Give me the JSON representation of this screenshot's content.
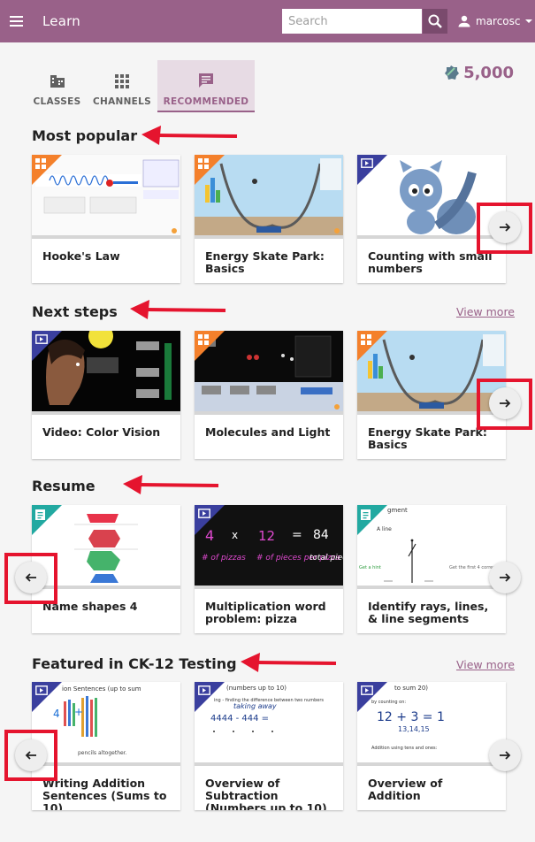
{
  "appbar": {
    "title": "Learn",
    "search_placeholder": "Search",
    "username": "marcosc"
  },
  "tabs": [
    {
      "label": "CLASSES",
      "icon": "classes-icon",
      "active": false
    },
    {
      "label": "CHANNELS",
      "icon": "channels-icon",
      "active": false
    },
    {
      "label": "RECOMMENDED",
      "icon": "recommended-icon",
      "active": true
    }
  ],
  "points": "5,000",
  "sections": [
    {
      "title": "Most popular",
      "view_more": "",
      "cards": [
        {
          "title": "Hooke's Law",
          "kind": "app"
        },
        {
          "title": "Energy Skate Park: Basics",
          "kind": "app"
        },
        {
          "title": "Counting with small numbers",
          "kind": "video"
        }
      ]
    },
    {
      "title": "Next steps",
      "view_more": "View more",
      "cards": [
        {
          "title": "Video: Color Vision",
          "kind": "video"
        },
        {
          "title": "Molecules and Light",
          "kind": "app"
        },
        {
          "title": "Energy Skate Park: Basics",
          "kind": "app"
        }
      ]
    },
    {
      "title": "Resume",
      "view_more": "",
      "cards": [
        {
          "title": "Name shapes 4",
          "kind": "exercise"
        },
        {
          "title": "Multiplication word problem: pizza",
          "kind": "video"
        },
        {
          "title": "Identify rays, lines, & line segments",
          "kind": "exercise"
        }
      ]
    },
    {
      "title": "Featured in CK-12 Testing",
      "view_more": "View more",
      "cards": [
        {
          "title": "Writing Addition Sentences (Sums to 10)",
          "kind": "video"
        },
        {
          "title": "Overview of Subtraction (Numbers up to 10)",
          "kind": "video"
        },
        {
          "title": "Overview of Addition",
          "kind": "video"
        }
      ]
    }
  ],
  "thumb_text": {
    "pizza_1": "4",
    "pizza_2": "x",
    "pizza_3": "12",
    "pizza_4": "=",
    "pizza_5": "84",
    "pizza_6": "# of pizzas",
    "pizza_7": "# of pieces per pizza",
    "pizza_8": "total pieces",
    "rays_1": "gment",
    "rays_2": "A line",
    "rays_3": "Get a hint",
    "rays_4": "Get the first 4 correct",
    "wa_1": "ion Sentences (up to sum",
    "wa_2": "4",
    "wa_3": "+",
    "wa_4": "pencils altogether.",
    "os_1": "(numbers up to 10)",
    "os_2": "taking away",
    "os_3": "ing - finding the difference between two numbers",
    "os_4": "4444 - 444 =",
    "oa_1": "to sum 20)",
    "oa_2": "by counting on:",
    "oa_3": "12 + 3 = 1",
    "oa_4": "13,14,15",
    "oa_5": "Addition using tens and ones:"
  },
  "colors": {
    "brand": "#996189",
    "annotation_red": "#e5142e",
    "app_corner": "#f4802b",
    "video_corner": "#3a3f9e",
    "exercise_corner": "#22a9a1"
  }
}
